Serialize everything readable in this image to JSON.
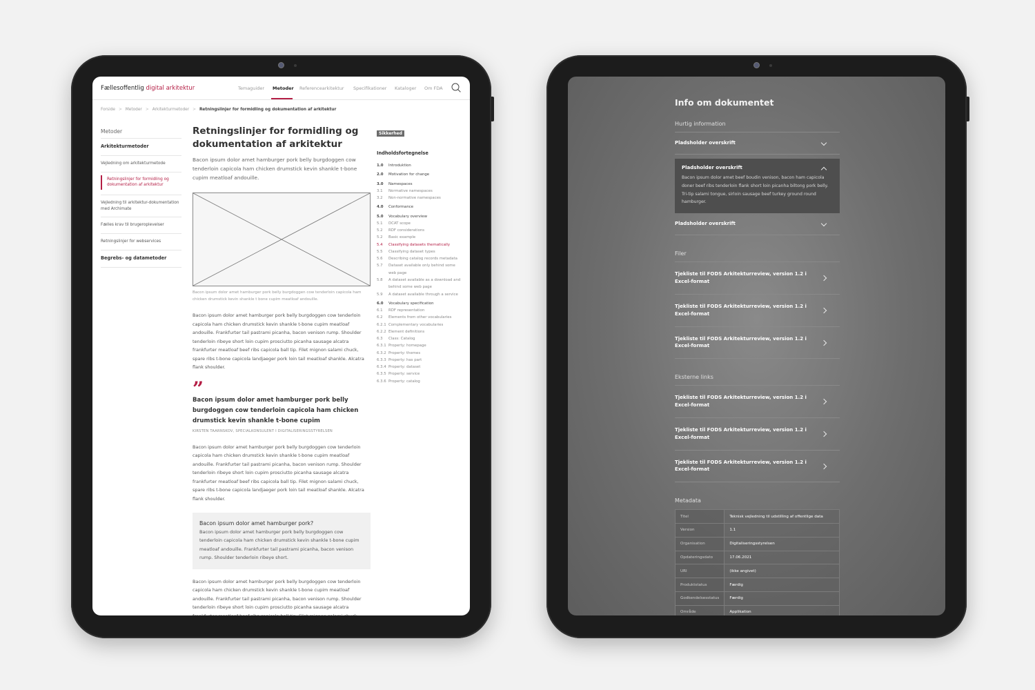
{
  "left": {
    "brand": {
      "prefix": "Fællesoffentlig ",
      "accent": "digital arkitektur"
    },
    "nav": [
      "Temaguider",
      "Metoder",
      "Referencearkitektur",
      "Specifikationer",
      "Kataloger",
      "Om FDA"
    ],
    "breadcrumb": [
      "Forside",
      "Metoder",
      "Arkitekturmetoder",
      "Retningslinjer for formidling og dokumentation af arkitektur"
    ],
    "sidebar": {
      "title": "Metoder",
      "section": "Arkitekturmetoder",
      "items": [
        "Vejledning om arkitekturmetode",
        "Retningslinjer for formidling og dokumentation af arkitektur",
        "Vejledning til arkitektur-dokumentation med Archimate",
        "Fælles krav til brugeroplevelser",
        "Retningslinjer for webservices"
      ],
      "footer": "Begrebs- og datametoder"
    },
    "main": {
      "title": "Retningslinjer for formidling og dokumentation af arkitektur",
      "lead": "Bacon ipsum dolor amet hamburger pork belly burgdoggen cow tenderloin capicola ham chicken drumstick kevin shankle t-bone cupim meatloaf andouille.",
      "caption": "Bacon ipsum dolor amet hamburger pork belly burgdoggen cow tenderloin capicola ham chicken drumstick kevin shankle t bone cupim meatloaf andouille.",
      "para1": "Bacon ipsum dolor amet hamburger pork belly burgdoggen cow tenderloin capicola ham chicken drumstick kevin shankle t-bone cupim meatloaf andouille. Frankfurter tail pastrami picanha, bacon venison rump. Shoulder tenderloin ribeye short loin cupim prosciutto picanha sausage alcatra frankfurter meatloaf beef ribs capicola ball tip. Filet mignon salami chuck, spare ribs t-bone capicola landjaeger pork loin tail meatloaf shankle. Alcatra flank shoulder.",
      "quote_mark": "”",
      "quote": "Bacon ipsum dolor amet hamburger pork belly burgdoggen cow tenderloin capicola ham chicken drumstick kevin shankle t-bone cupim",
      "quote_by": "KIRSTEN TAARNSKOV, SPECIALKONSULENT I DIGITALISERINGSSTYRELSEN",
      "para2": "Bacon ipsum dolor amet hamburger pork belly burgdoggen cow tenderloin capicola ham chicken drumstick kevin shankle t-bone cupim meatloaf andouille. Frankfurter tail pastrami picanha, bacon venison rump. Shoulder tenderloin ribeye short loin cupim prosciutto picanha sausage alcatra frankfurter meatloaf beef ribs capicola ball tip. Filet mignon salami chuck, spare ribs t-bone capicola landjaeger pork loin tail meatloaf shankle. Alcatra flank shoulder.",
      "infobox_title": "Bacon ipsum dolor amet hamburger pork?",
      "infobox_text": "Bacon ipsum dolor amet hamburger pork belly burgdoggen cow tenderloin capicola ham chicken drumstick kevin shankle t-bone cupim meatloaf andouille. Frankfurter tail pastrami picanha, bacon venison rump. Shoulder tenderloin ribeye short.",
      "para3": "Bacon ipsum dolor amet hamburger pork belly burgdoggen cow tenderloin capicola ham chicken drumstick kevin shankle t-bone cupim meatloaf andouille. Frankfurter tail pastrami picanha, bacon venison rump. Shoulder tenderloin ribeye short loin cupim prosciutto picanha sausage alcatra frankfurter meatloaf beef ribs capicola ball tip. Filet mignon salami chuck, spare ribs t-bone capicola landjaeger pork loin tail meatloaf shankle. Alcatra flank shoulder."
    },
    "toc": {
      "tag": "Sikkerhed",
      "title": "Indholdsfortegnelse",
      "rows": [
        {
          "n": "1.0",
          "t": "Introduktion",
          "major": true
        },
        {
          "n": "2.0",
          "t": "Motivation for change",
          "major": true
        },
        {
          "n": "3.0",
          "t": "Namespaces",
          "major": true
        },
        {
          "n": "3.1",
          "t": "Normative namespaces"
        },
        {
          "n": "3.2",
          "t": "Non-normative namespaces"
        },
        {
          "n": "4.0",
          "t": "Conformance",
          "major": true
        },
        {
          "n": "5.0",
          "t": "Vocabulary overview",
          "major": true
        },
        {
          "n": "5.1",
          "t": "DCAT scope"
        },
        {
          "n": "5.2",
          "t": "RDF considerations"
        },
        {
          "n": "5.2",
          "t": "Basic example"
        },
        {
          "n": "5.4",
          "t": "Classifying datasets thematically",
          "hl": true
        },
        {
          "n": "5.5",
          "t": "Classifying dataset types"
        },
        {
          "n": "5.6",
          "t": "Describing catalog records metadata"
        },
        {
          "n": "5.7",
          "t": "Dataset available only behind some web page"
        },
        {
          "n": "5.8",
          "t": "A dataset available as a download and behind some web page"
        },
        {
          "n": "5.9",
          "t": "A dataset available through a service"
        },
        {
          "n": "6.0",
          "t": "Vocabulary specification",
          "major": true
        },
        {
          "n": "6.1",
          "t": "RDF representation"
        },
        {
          "n": "6.2",
          "t": "Elements from other vocabularies"
        },
        {
          "n": "6.2.1",
          "t": "Complementary vocabularies"
        },
        {
          "n": "6.2.2",
          "t": "Element definitions"
        },
        {
          "n": "6.3",
          "t": "Class: Catalog"
        },
        {
          "n": "6.3.1",
          "t": "Property: homepage"
        },
        {
          "n": "6.3.2",
          "t": "Property: themes"
        },
        {
          "n": "6.3.3",
          "t": "Property: has part"
        },
        {
          "n": "6.3.4",
          "t": "Property: dataset"
        },
        {
          "n": "6.3.5",
          "t": "Property: service"
        },
        {
          "n": "6.3.6",
          "t": "Property: catalog"
        }
      ]
    }
  },
  "right": {
    "title": "Info om dokumentet",
    "quick_title": "Hurtig information",
    "accordion": [
      {
        "label": "Pladsholder overskrift",
        "open": false
      },
      {
        "label": "Pladsholder overskrift",
        "open": true,
        "body": "Bacon ipsum dolor amet beef boudin venison, bacon ham capicola doner beef ribs tenderloin flank short loin picanha biltong pork belly. Tri-tip salami tongue, sirloin sausage beef turkey ground round hamburger."
      },
      {
        "label": "Pladsholder overskrift",
        "open": false
      }
    ],
    "files_title": "Filer",
    "files": [
      "Tjekliste til FODS Arkitekturreview, version 1.2 i Excel-format",
      "Tjekliste til FODS Arkitekturreview, version 1.2 i Excel-format",
      "Tjekliste til FODS Arkitekturreview, version 1.2 i Excel-format"
    ],
    "links_title": "Eksterne links",
    "links": [
      "Tjekliste til FODS Arkitekturreview, version 1.2 i Excel-format",
      "Tjekliste til FODS Arkitekturreview, version 1.2 i Excel-format",
      "Tjekliste til FODS Arkitekturreview, version 1.2 i Excel-format"
    ],
    "meta_title": "Metadata",
    "metadata": [
      {
        "k": "Titel",
        "v": "Teknisk vejledning til udstilling af offentlige data"
      },
      {
        "k": "Version",
        "v": "1.1"
      },
      {
        "k": "Organisation",
        "v": "Digitaliseringsstyrelsen"
      },
      {
        "k": "Opdateringsdato",
        "v": "17.06.2021"
      },
      {
        "k": "URI",
        "v": "(ikke angivet)"
      },
      {
        "k": "Produktstatus",
        "v": "Færdig"
      },
      {
        "k": "Godkendelsesstatus",
        "v": "Færdig"
      },
      {
        "k": "Område",
        "v": "Applikation"
      }
    ]
  }
}
